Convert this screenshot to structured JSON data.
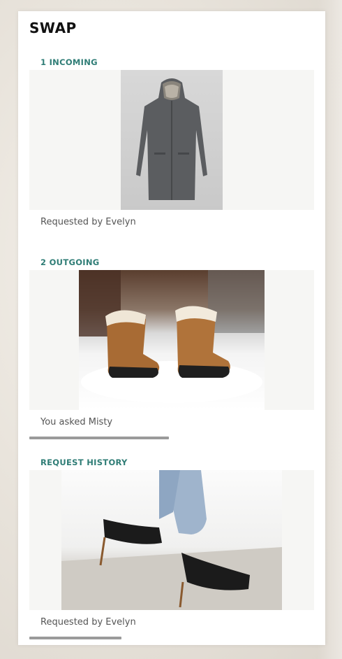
{
  "page": {
    "title": "SWAP"
  },
  "sections": [
    {
      "label": "1 INCOMING",
      "caption": "Requested by Evelyn",
      "image": "gray-hooded-parka"
    },
    {
      "label": "2 OUTGOING",
      "caption": "You asked Misty",
      "image": "tan-winter-boots-in-snow"
    },
    {
      "label": "REQUEST HISTORY",
      "caption": "Requested by Evelyn",
      "image": "black-suede-heels"
    }
  ],
  "colors": {
    "accent": "#2f7d76",
    "scrollbar": "#9a9a9a",
    "frame": "#f6f6f4"
  }
}
